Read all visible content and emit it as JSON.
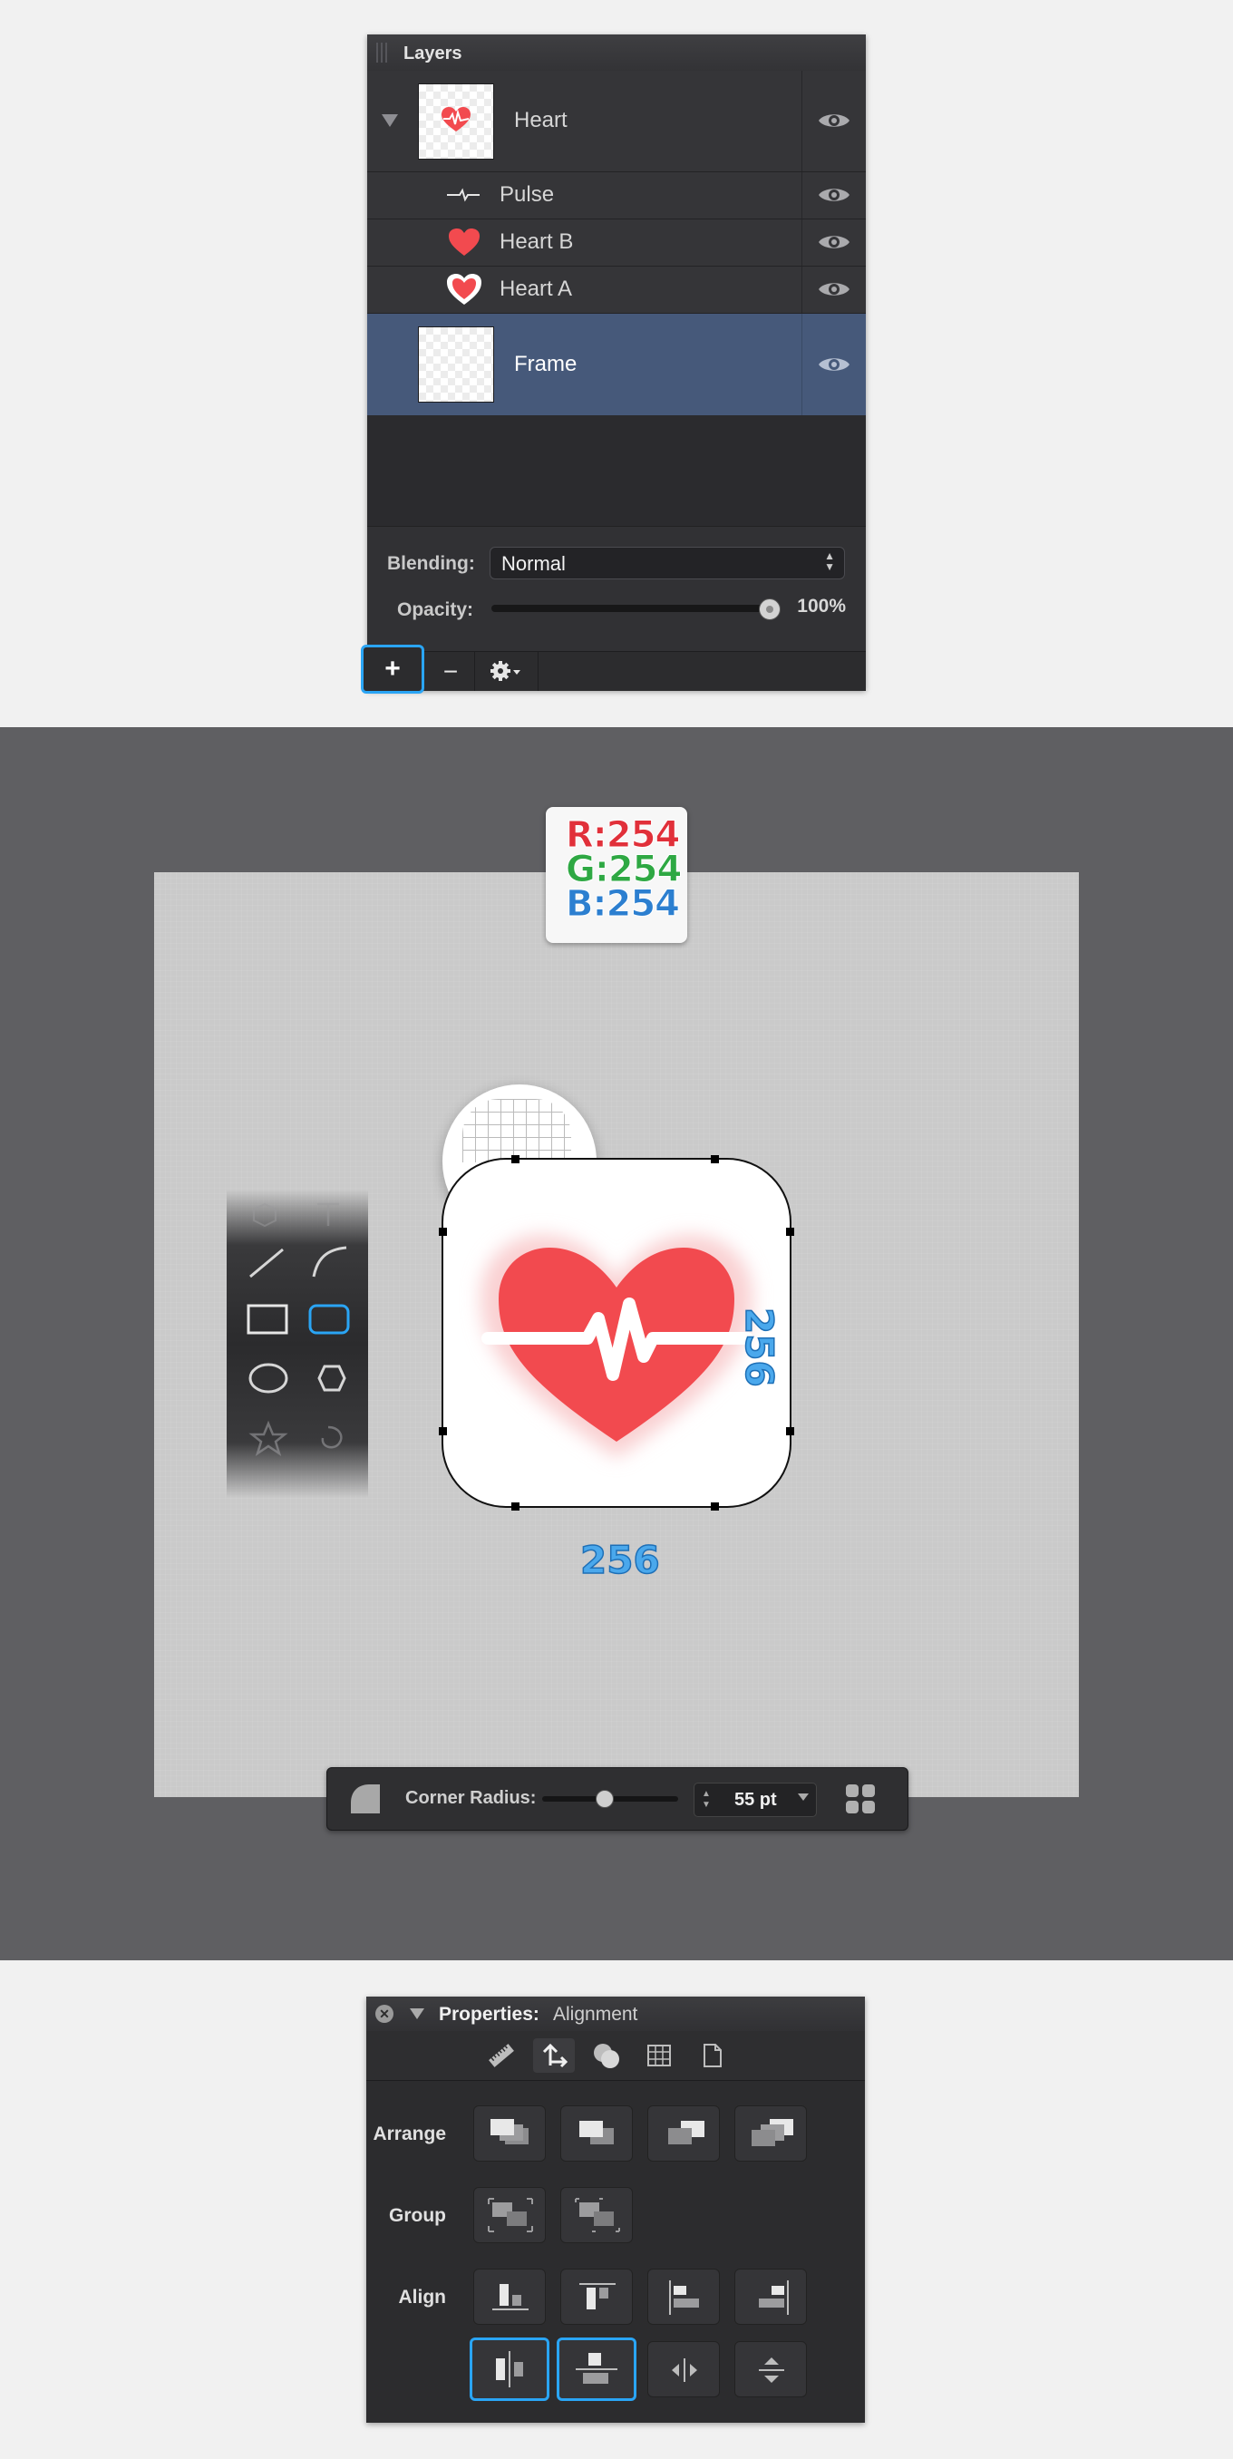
{
  "layers_panel": {
    "title": "Layers",
    "layers": [
      {
        "name": "Heart",
        "type": "group",
        "expanded": true
      },
      {
        "name": "Pulse",
        "type": "path",
        "indent": 1
      },
      {
        "name": "Heart B",
        "type": "shape",
        "indent": 1
      },
      {
        "name": "Heart A",
        "type": "shape",
        "indent": 1
      },
      {
        "name": "Frame",
        "type": "shape",
        "selected": true
      }
    ],
    "blending_label": "Blending:",
    "blending_value": "Normal",
    "opacity_label": "Opacity:",
    "opacity_value": "100%",
    "opacity_fraction": 1.0,
    "toolbar": {
      "add": "+",
      "remove": "−",
      "gear": "gear-icon"
    }
  },
  "canvas": {
    "color_readout": {
      "r": "R:254",
      "g": "G:254",
      "b": "B:254"
    },
    "dimension_height": "256",
    "dimension_width": "256",
    "corner_radius": {
      "label": "Corner Radius:",
      "value": "55 pt",
      "fraction": 0.45
    },
    "colors": {
      "heart": "#f24a4f",
      "highlight": "#2aa5f5",
      "selection": "#46597a"
    }
  },
  "properties_panel": {
    "title": "Properties:",
    "subtitle": "Alignment",
    "tabs": [
      "ruler-icon",
      "transform-icon",
      "style-icon",
      "grid-icon",
      "page-icon"
    ],
    "sections": {
      "arrange": "Arrange",
      "group": "Group",
      "align": "Align"
    }
  }
}
